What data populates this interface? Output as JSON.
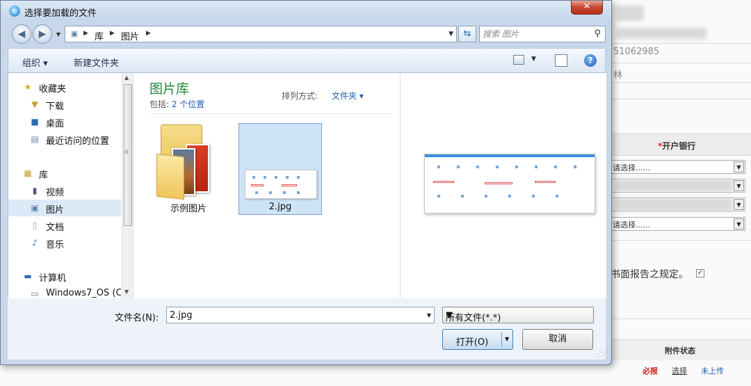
{
  "dialog": {
    "title": "选择要加载的文件",
    "close_label": "✕"
  },
  "address": {
    "crumbs": [
      "库",
      "图片"
    ],
    "search_placeholder": "搜索 图片"
  },
  "toolbar": {
    "organize_label": "组织 ▾",
    "new_folder_label": "新建文件夹"
  },
  "nav": {
    "favorites": "收藏夹",
    "downloads": "下载",
    "desktop": "桌面",
    "recent": "最近访问的位置",
    "libraries": "库",
    "videos": "视频",
    "pictures": "图片",
    "documents": "文档",
    "music": "音乐",
    "computer": "计算机",
    "drive": "Windows7_OS (C"
  },
  "library": {
    "title": "图片库",
    "includes_prefix": "包括: ",
    "includes_link": "2 个位置",
    "arrange_label": "排列方式:",
    "arrange_value": "文件夹 ▾"
  },
  "files": [
    {
      "name": "示例图片",
      "type": "folder"
    },
    {
      "name": "2.jpg",
      "type": "image"
    }
  ],
  "bottom": {
    "filename_label": "文件名(N):",
    "filename_value": "2.jpg",
    "filetype_value": "所有文件(*.*)",
    "open_label": "打开(O)",
    "cancel_label": "取消"
  },
  "background": {
    "phone_fragment": "51062985",
    "name_fragment": "林",
    "bank_header_required": "*",
    "bank_header": "开户银行",
    "select_placeholder": "请选择......",
    "report_text": "书面报告之规定。",
    "attachment_status_header": "附件状态",
    "required_label": "必报",
    "select_link": "选择",
    "not_uploaded": "未上传"
  },
  "colors": {
    "library_title": "#1e8a3c",
    "link": "#1f5fb0",
    "required_red": "#d22222",
    "selection": "#cde3f8"
  }
}
